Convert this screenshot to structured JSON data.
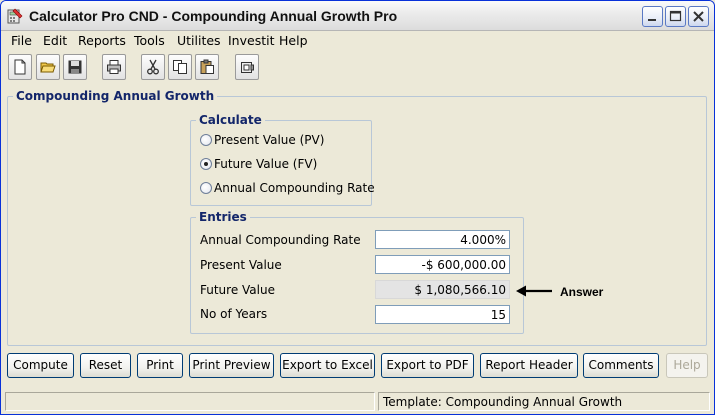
{
  "window": {
    "title": "Calculator Pro CND - Compounding Annual Growth Pro"
  },
  "menu": {
    "items": [
      "File",
      "Edit",
      "Reports",
      "Tools",
      "Utilites",
      "Investit",
      "Help"
    ]
  },
  "toolbar": {
    "buttons": [
      "new-file-icon",
      "open-folder-icon",
      "save-icon",
      "print-icon",
      "cut-icon",
      "copy-icon",
      "paste-icon",
      "calculator-icon"
    ]
  },
  "main_panel": {
    "title": "Compounding Annual Growth"
  },
  "calculate": {
    "title": "Calculate",
    "options": [
      {
        "label": "Present Value (PV)",
        "checked": false
      },
      {
        "label": "Future Value (FV)",
        "checked": true
      },
      {
        "label": "Annual Compounding Rate",
        "checked": false
      }
    ]
  },
  "entries": {
    "title": "Entries",
    "fields": [
      {
        "label": "Annual Compounding Rate",
        "value": "4.000%",
        "readonly": false
      },
      {
        "label": "Present Value",
        "value": "-$ 600,000.00",
        "readonly": false
      },
      {
        "label": "Future Value",
        "value": "$ 1,080,566.10",
        "readonly": true
      },
      {
        "label": "No of Years",
        "value": "15",
        "readonly": false
      }
    ]
  },
  "annotation": {
    "label": "Answer"
  },
  "buttons": {
    "compute": "Compute",
    "reset": "Reset",
    "print": "Print",
    "print_preview": "Print Preview",
    "export_excel": "Export to Excel",
    "export_pdf": "Export to PDF",
    "report_header": "Report Header",
    "comments": "Comments",
    "help": "Help"
  },
  "status": {
    "left": "",
    "right": "Template: Compounding Annual Growth"
  },
  "colors": {
    "window_bg": "#ece9d8",
    "group_title": "#13266a",
    "group_border": "#b8c7d7"
  }
}
